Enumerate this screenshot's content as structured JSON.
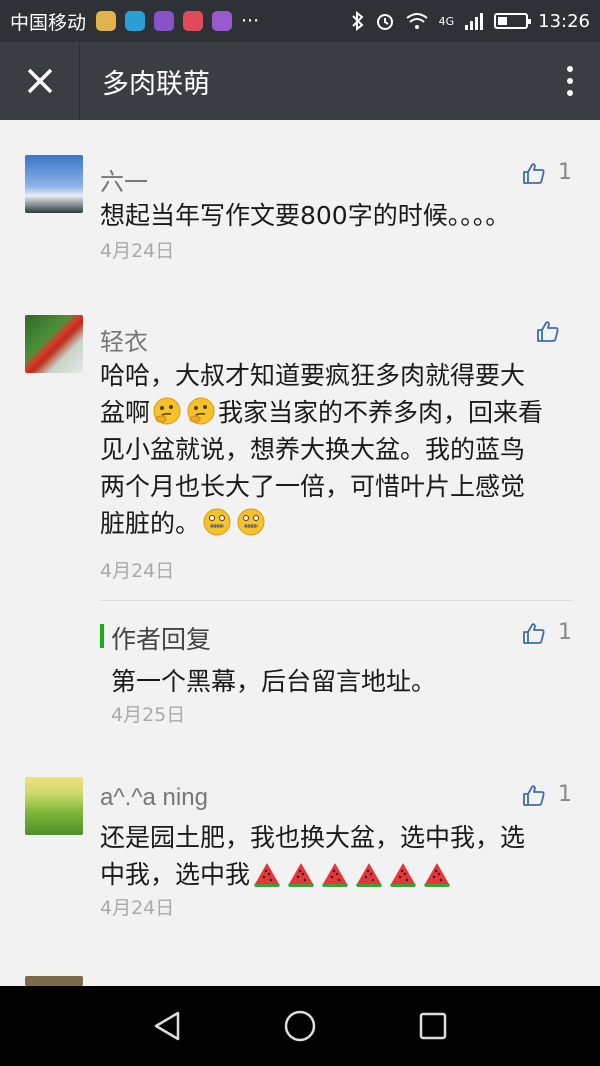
{
  "status": {
    "carrier": "中国移动",
    "network": "4G",
    "time": "13:26",
    "battery_level": 0.35
  },
  "header": {
    "title": "多肉联萌"
  },
  "comments": [
    {
      "name": "六一",
      "likes": "1",
      "date": "4月24日",
      "line1": "想起当年写作文要800字的时候。。。。"
    },
    {
      "name": "轻衣",
      "date": "4月24日",
      "line1": "哈哈，大叔才知道要疯狂多肉就得要大",
      "line2a": "盆啊",
      "line2b": "我家当家的不养多肉，回来看",
      "line3": "见小盆就说，想养大换大盆。我的蓝鸟",
      "line4": "两个月也长大了一倍，可惜叶片上感觉",
      "line5": "脏脏的。",
      "reply": {
        "title": "作者回复",
        "likes": "1",
        "text": "第一个黑幕，后台留言地址。",
        "date": "4月25日"
      }
    },
    {
      "name": "a^.^a ning",
      "likes": "1",
      "date": "4月24日",
      "line1": "还是园土肥，我也换大盆，选中我，选",
      "line2": "中我，选中我"
    }
  ],
  "icons": {
    "close": "close-icon",
    "more": "more-vertical-icon",
    "like": "thumbs-up-icon",
    "back": "back-triangle-icon",
    "home": "home-circle-icon",
    "recent": "recent-square-icon",
    "emoji_thinking": "thinking-face-emoji",
    "emoji_zipper": "zipper-mouth-face-emoji",
    "emoji_watermelon": "watermelon-emoji"
  }
}
